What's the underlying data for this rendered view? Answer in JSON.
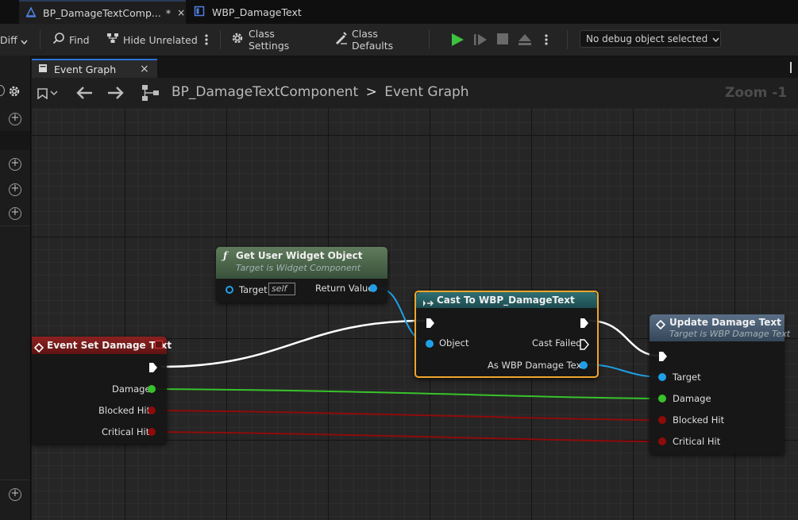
{
  "doc_tabs": [
    {
      "label": "BP_DamageTextComp...",
      "modified": "*"
    },
    {
      "label": "WBP_DamageText"
    }
  ],
  "toolbar": {
    "diff_label": "Diff",
    "find_label": "Find",
    "hide_unrelated_label": "Hide Unrelated",
    "class_settings_label": "Class Settings",
    "class_defaults_label": "Class Defaults",
    "debug_object": "No debug object selected"
  },
  "graph_tab": {
    "label": "Event Graph",
    "close": "×"
  },
  "breadcrumb": {
    "blueprint": "BP_DamageTextComponent",
    "separator": ">",
    "graph": "Event Graph"
  },
  "zoom_label": "Zoom -1",
  "nodes": {
    "get_widget": {
      "title": "Get User Widget Object",
      "subtitle": "Target is Widget Component",
      "target_label": "Target",
      "target_value": "self",
      "return_label": "Return Value"
    },
    "cast": {
      "title": "Cast To WBP_DamageText",
      "object_label": "Object",
      "failed_label": "Cast Failed",
      "as_label": "As WBP Damage Text"
    },
    "event": {
      "title": "Event Set Damage Text",
      "damage_label": "Damage",
      "blocked_label": "Blocked Hit",
      "critical_label": "Critical Hit"
    },
    "update": {
      "title": "Update Damage Text",
      "subtitle": "Target is WBP Damage Text",
      "target_label": "Target",
      "damage_label": "Damage",
      "blocked_label": "Blocked Hit",
      "critical_label": "Critical Hit"
    }
  },
  "colors": {
    "exec_wire": "#ffffff",
    "object_pin": "#1fa0e6",
    "float_pin": "#38c22b",
    "bool_pin": "#8e0b0b",
    "cast_border": "#f0a52a",
    "play_green": "#3ec33e"
  }
}
